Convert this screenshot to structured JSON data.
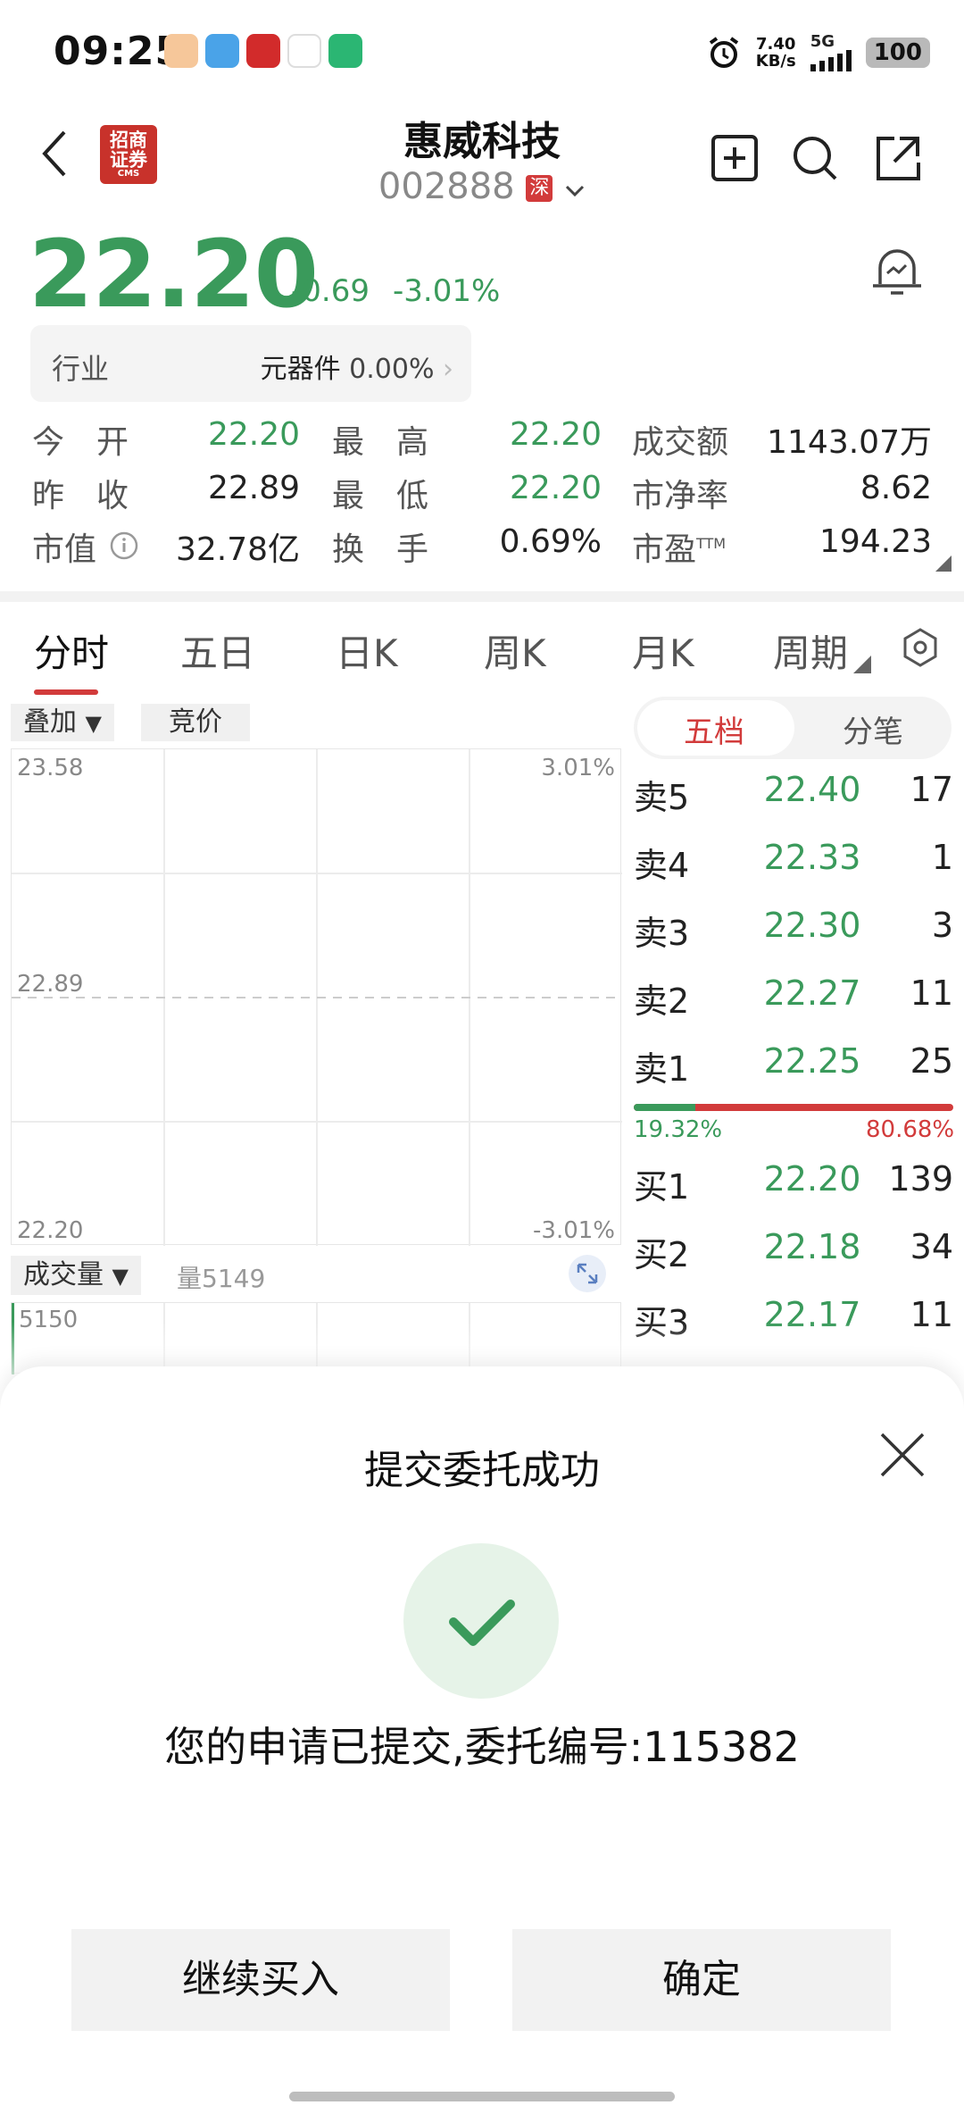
{
  "status": {
    "time": "09:25",
    "net_speed_value": "7.40",
    "net_speed_unit": "KB/s",
    "network": "5G",
    "battery": "100"
  },
  "header": {
    "broker_logo_text": "招商证券",
    "broker_logo_sub": "CMS",
    "stock_name": "惠威科技",
    "stock_code": "002888",
    "market": "深"
  },
  "quote": {
    "price": "22.20",
    "change": "-0.69",
    "change_pct": "-3.01%",
    "industry_label": "行业",
    "industry_name": "元器件",
    "industry_change": "0.00%"
  },
  "stats": {
    "open_label": "今　开",
    "open": "22.20",
    "high_label": "最　高",
    "high": "22.20",
    "turnover_amt_label": "成交额",
    "turnover_amt": "1143.07万",
    "prev_close_label": "昨　收",
    "prev_close": "22.89",
    "low_label": "最　低",
    "low": "22.20",
    "pb_label": "市净率",
    "pb": "8.62",
    "mktcap_label": "市值",
    "mktcap": "32.78亿",
    "turnover_rate_label": "换　手",
    "turnover_rate": "0.69%",
    "pe_label": "市盈",
    "pe_sup": "TTM",
    "pe": "194.23"
  },
  "tabs": [
    "分时",
    "五日",
    "日K",
    "周K",
    "月K",
    "周期"
  ],
  "chart": {
    "overlay_label": "叠加",
    "auction_label": "竞价",
    "y_top": "23.58",
    "y_mid": "22.89",
    "y_bottom": "22.20",
    "pct_top": "3.01%",
    "pct_bottom": "-3.01%",
    "volume_label": "成交量",
    "volume_text": "量5149",
    "volume_axis_top": "5150"
  },
  "orderbook": {
    "tab_active": "五档",
    "tab_other": "分笔",
    "asks": [
      {
        "label": "卖5",
        "price": "22.40",
        "vol": "17"
      },
      {
        "label": "卖4",
        "price": "22.33",
        "vol": "1"
      },
      {
        "label": "卖3",
        "price": "22.30",
        "vol": "3"
      },
      {
        "label": "卖2",
        "price": "22.27",
        "vol": "11"
      },
      {
        "label": "卖1",
        "price": "22.25",
        "vol": "25"
      }
    ],
    "buy_ratio": "19.32%",
    "sell_ratio": "80.68%",
    "bids": [
      {
        "label": "买1",
        "price": "22.20",
        "vol": "139"
      },
      {
        "label": "买2",
        "price": "22.18",
        "vol": "34"
      },
      {
        "label": "买3",
        "price": "22.17",
        "vol": "11"
      }
    ]
  },
  "modal": {
    "title": "提交委托成功",
    "message": "您的申请已提交,委托编号:115382",
    "continue_label": "继续买入",
    "confirm_label": "确定"
  },
  "colors": {
    "up": "#d23b3b",
    "down": "#3a9a5b"
  }
}
